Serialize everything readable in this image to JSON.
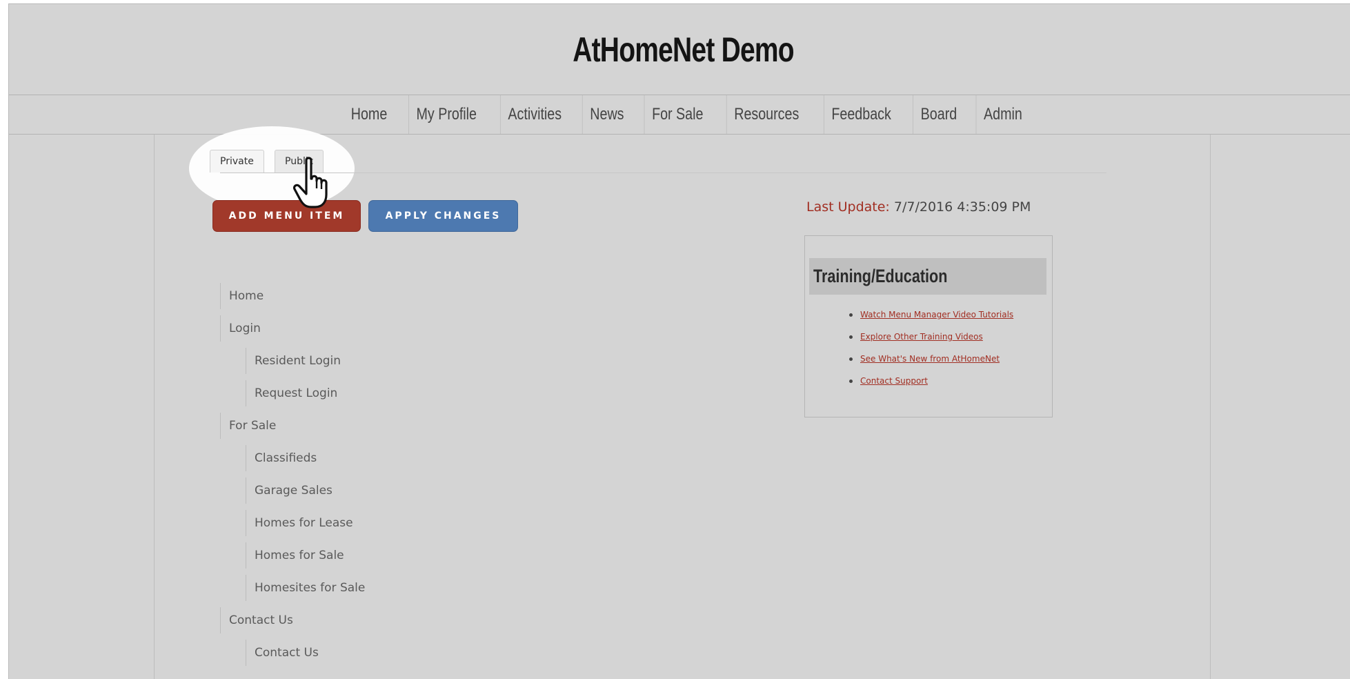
{
  "site": {
    "title": "AtHomeNet Demo"
  },
  "nav": {
    "items": [
      {
        "label": "Home"
      },
      {
        "label": "My Profile"
      },
      {
        "label": "Activities"
      },
      {
        "label": "News"
      },
      {
        "label": "For Sale"
      },
      {
        "label": "Resources"
      },
      {
        "label": "Feedback"
      },
      {
        "label": "Board"
      },
      {
        "label": "Admin"
      }
    ]
  },
  "tabs": {
    "private": "Private",
    "public": "Public",
    "active": "Public"
  },
  "buttons": {
    "add_menu_item": "ADD MENU ITEM",
    "apply_changes": "APPLY CHANGES"
  },
  "last_update": {
    "label": "Last Update:",
    "value": "7/7/2016 4:35:09 PM"
  },
  "training": {
    "title": "Training/Education",
    "links": [
      "Watch Menu Manager Video Tutorials",
      "Explore Other Training Videos",
      "See What's New from AtHomeNet",
      "Contact Support"
    ]
  },
  "menu_tree": [
    {
      "label": "Home",
      "level": 0
    },
    {
      "label": "Login",
      "level": 0
    },
    {
      "label": "Resident Login",
      "level": 1
    },
    {
      "label": "Request Login",
      "level": 1
    },
    {
      "label": "For Sale",
      "level": 0
    },
    {
      "label": "Classifieds",
      "level": 1
    },
    {
      "label": "Garage Sales",
      "level": 1
    },
    {
      "label": "Homes for Lease",
      "level": 1
    },
    {
      "label": "Homes for Sale",
      "level": 1
    },
    {
      "label": "Homesites for Sale",
      "level": 1
    },
    {
      "label": "Contact Us",
      "level": 0
    },
    {
      "label": "Contact Us",
      "level": 1
    }
  ],
  "colors": {
    "background": "#d4d4d4",
    "add_button": "#a1392a",
    "apply_button": "#4d79b0",
    "accent_text": "#a12e22"
  },
  "icons": {
    "cursor": "hand-pointer-icon"
  }
}
